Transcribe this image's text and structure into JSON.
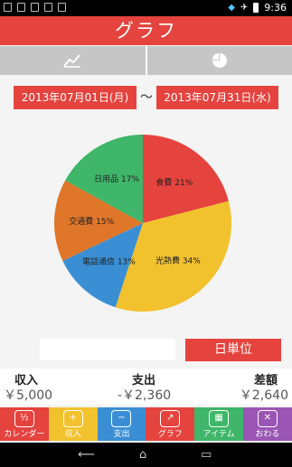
{
  "statusbar": {
    "time": "9:36"
  },
  "appbar": {
    "title": "グラフ"
  },
  "tabs": [
    {
      "icon": "line-chart-icon"
    },
    {
      "icon": "pie-chart-icon"
    }
  ],
  "period": {
    "start": "2013年07月01日(月)",
    "separator": "〜",
    "end": "2013年07月31日(水)"
  },
  "unit_button": "日単位",
  "summary": {
    "income_label": "収入",
    "income_value": "￥5,000",
    "expense_label": "支出",
    "expense_value": "-￥2,360",
    "diff_label": "差額",
    "diff_value": "￥2,640"
  },
  "nav": [
    {
      "label": "カレンダー",
      "icon": "calendar-icon"
    },
    {
      "label": "収入",
      "icon": "income-icon"
    },
    {
      "label": "支出",
      "icon": "expense-icon"
    },
    {
      "label": "グラフ",
      "icon": "graph-icon"
    },
    {
      "label": "アイテム",
      "icon": "item-icon"
    },
    {
      "label": "おわる",
      "icon": "exit-icon"
    }
  ],
  "colors": {
    "accent": "#e5433e",
    "yellow": "#f2c12e",
    "blue": "#3a8fd4",
    "orange": "#e0762a",
    "green": "#3fb669",
    "purple": "#9b55b4"
  },
  "chart_data": {
    "type": "pie",
    "slices": [
      {
        "label": "食費",
        "value": 21,
        "color": "#e5433e",
        "text": "食費 21%"
      },
      {
        "label": "光熱費",
        "value": 34,
        "color": "#f2c12e",
        "text": "光熱費 34%"
      },
      {
        "label": "電話通信",
        "value": 13,
        "color": "#3a8fd4",
        "text": "電話通信 13%"
      },
      {
        "label": "交通費",
        "value": 15,
        "color": "#e0762a",
        "text": "交通費 15%"
      },
      {
        "label": "日用品",
        "value": 17,
        "color": "#3fb669",
        "text": "日用品 17%"
      }
    ]
  }
}
